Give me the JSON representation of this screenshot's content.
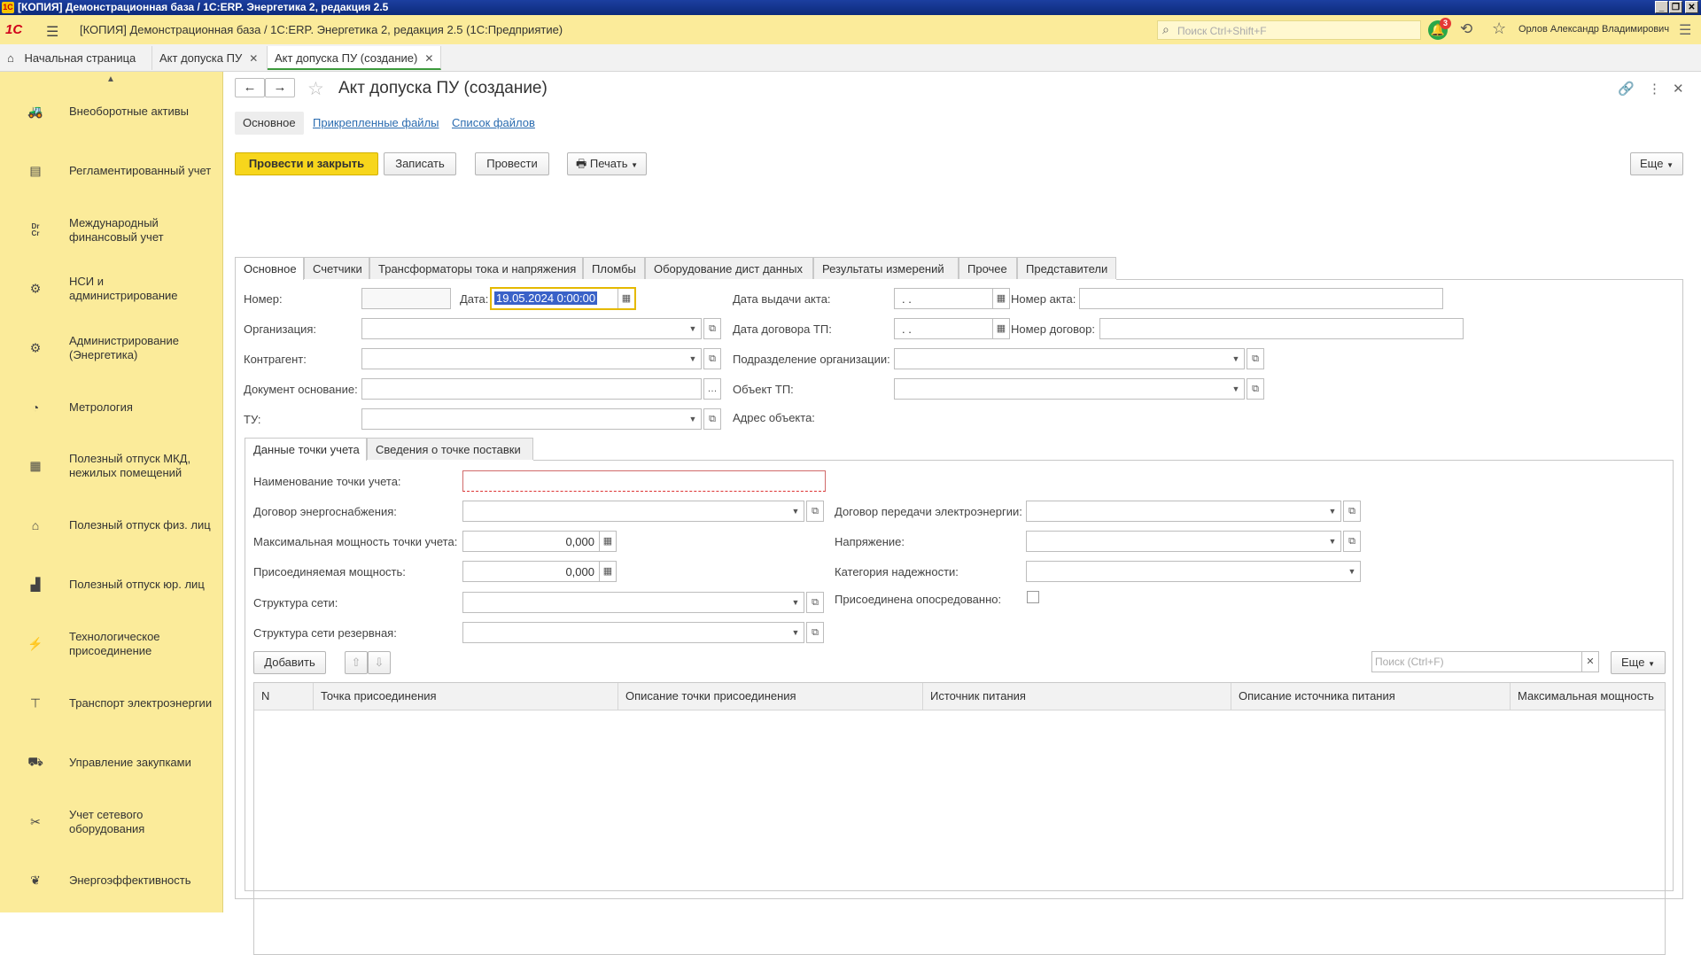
{
  "window": {
    "title": "[КОПИЯ] Демонстрационная база / 1С:ERP. Энергетика 2, редакция 2.5",
    "logo": "1С"
  },
  "app_header": {
    "brand": "1С",
    "title": "[КОПИЯ] Демонстрационная база / 1С:ERP. Энергетика 2, редакция 2.5  (1С:Предприятие)",
    "search_placeholder": "Поиск Ctrl+Shift+F",
    "notifications_count": "3",
    "user": "Орлов Александр Владимирович"
  },
  "open_tabs": [
    {
      "label": "Начальная страница"
    },
    {
      "label": "Акт допуска ПУ"
    },
    {
      "label": "Акт допуска ПУ (создание)"
    }
  ],
  "sidebar": {
    "items": [
      {
        "label": "Внеоборотные активы",
        "icon": "car-icon"
      },
      {
        "label": "Регламентированный учет",
        "icon": "ledger-icon"
      },
      {
        "label": "Международный финансовый учет",
        "icon": "dr-cr-icon"
      },
      {
        "label": "НСИ и администрирование",
        "icon": "gear-icon"
      },
      {
        "label": "Администрирование (Энергетика)",
        "icon": "gear-icon"
      },
      {
        "label": "Метрология",
        "icon": "gauge-icon"
      },
      {
        "label": "Полезный отпуск МКД, нежилых помещений",
        "icon": "building-icon"
      },
      {
        "label": "Полезный отпуск физ. лиц",
        "icon": "house-icon"
      },
      {
        "label": "Полезный отпуск юр. лиц",
        "icon": "factory-icon"
      },
      {
        "label": "Технологическое присоединение",
        "icon": "tower-icon"
      },
      {
        "label": "Транспорт электроэнергии",
        "icon": "pole-icon"
      },
      {
        "label": "Управление закупками",
        "icon": "cart-icon"
      },
      {
        "label": "Учет сетевого оборудования",
        "icon": "tools-icon"
      },
      {
        "label": "Энергоэффективность",
        "icon": "leaf-icon"
      }
    ]
  },
  "form": {
    "title": "Акт допуска ПУ (создание)",
    "panel": {
      "main": "Основное",
      "attached": "Прикрепленные файлы",
      "files_list": "Список файлов"
    },
    "toolbar": {
      "post_close": "Провести и закрыть",
      "save": "Записать",
      "post": "Провести",
      "print": "Печать",
      "more": "Еще"
    },
    "tabs": [
      "Основное",
      "Счетчики",
      "Трансформаторы тока и напряжения",
      "Пломбы",
      "Оборудование дист данных",
      "Результаты измерений",
      "Прочее",
      "Представители"
    ],
    "fields": {
      "number_label": "Номер:",
      "number_value": "",
      "date_label": "Дата:",
      "date_value": "19.05.2024  0:00:00",
      "org_label": "Организация:",
      "contractor_label": "Контрагент:",
      "base_doc_label": "Документ основание:",
      "tu_label": "ТУ:",
      "act_date_label": "Дата выдачи акта:",
      "act_date_value": " .  .",
      "act_number_label": "Номер акта:",
      "tp_contract_date_label": "Дата договора ТП:",
      "tp_contract_date_value": " .  .",
      "contract_number_label": "Номер договор:",
      "division_label": "Подразделение организации:",
      "tp_object_label": "Объект ТП:",
      "address_label": "Адрес объекта:"
    },
    "subtabs": [
      "Данные точки учета",
      "Сведения о точке поставки"
    ],
    "point": {
      "name_label": "Наименование точки учета:",
      "supply_contract_label": "Договор энергоснабжения:",
      "max_power_label": "Максимальная мощность точки учета:",
      "max_power_value": "0,000",
      "connected_power_label": "Присоединяемая мощность:",
      "connected_power_value": "0,000",
      "network_label": "Структура сети:",
      "network_reserve_label": "Структура сети резервная:",
      "transfer_contract_label": "Договор передачи электроэнергии:",
      "voltage_label": "Напряжение:",
      "reliability_label": "Категория надежности:",
      "indirect_label": "Присоединена опосредованно:"
    },
    "table": {
      "add": "Добавить",
      "search_placeholder": "Поиск (Ctrl+F)",
      "more": "Еще",
      "columns": [
        "N",
        "Точка присоединения",
        "Описание точки присоединения",
        "Источник питания",
        "Описание источника питания",
        "Максимальная мощность"
      ]
    }
  }
}
